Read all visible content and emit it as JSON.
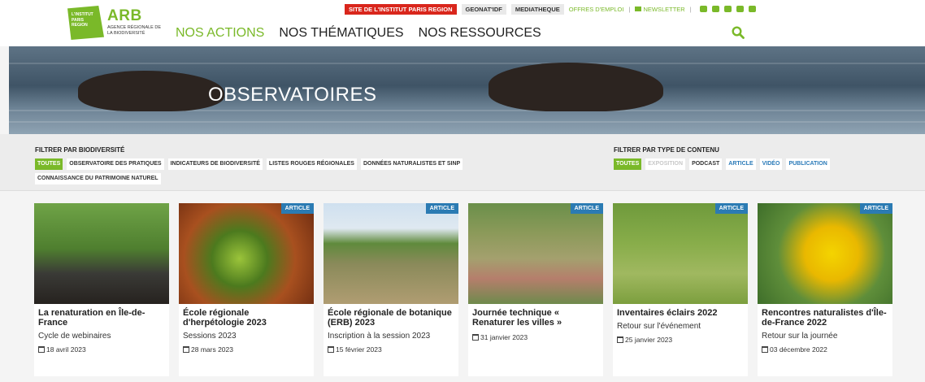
{
  "logo": {
    "box_lines": [
      "L'INSTITUT",
      "PARIS",
      "REGION"
    ],
    "name": "ARB",
    "subtitle": "AGENCE RÉGIONALE DE LA BIODIVERSITÉ"
  },
  "topbar": {
    "site_link": "SITE DE L'INSTITUT PARIS REGION",
    "geonat": "GEONAT'IDF",
    "mediatheque": "MEDIATHEQUE",
    "offres": "OFFRES D'EMPLOI",
    "separator": "|",
    "newsletter": "NEWSLETTER",
    "separator2": "|"
  },
  "nav": {
    "items": [
      "NOS ACTIONS",
      "NOS THÉMATIQUES",
      "NOS RESSOURCES"
    ]
  },
  "hero": {
    "title": "OBSERVATOIRES"
  },
  "filters": {
    "biodiversite": {
      "label": "FILTRER PAR BIODIVERSITÉ",
      "chips": [
        "TOUTES",
        "OBSERVATOIRE DES PRATIQUES",
        "INDICATEURS DE BIODIVERSITÉ",
        "LISTES ROUGES RÉGIONALES",
        "DONNÉES NATURALISTES ET SINP",
        "CONNAISSANCE DU PATRIMOINE NATUREL"
      ]
    },
    "type": {
      "label": "FILTRER PAR TYPE DE CONTENU",
      "chips": [
        "TOUTES",
        "EXPOSITION",
        "PODCAST",
        "ARTICLE",
        "VIDÉO",
        "PUBLICATION"
      ]
    }
  },
  "colors": {
    "accent": "#7ab929",
    "badge": "#2b7bb3",
    "red": "#d9261c"
  },
  "cards": [
    {
      "badge": "",
      "title": "La renaturation en Île-de-France",
      "subtitle": "Cycle de webinaires",
      "date": "18 avril 2023"
    },
    {
      "badge": "ARTICLE",
      "title": "École régionale d'herpétologie 2023",
      "subtitle": "Sessions 2023",
      "date": "28 mars 2023"
    },
    {
      "badge": "ARTICLE",
      "title": "École régionale de botanique (ERB) 2023",
      "subtitle": "Inscription à la session 2023",
      "date": "15 février 2023"
    },
    {
      "badge": "ARTICLE",
      "title": "Journée technique « Renaturer les villes »",
      "subtitle": "",
      "date": "31 janvier 2023"
    },
    {
      "badge": "ARTICLE",
      "title": "Inventaires éclairs 2022",
      "subtitle": "Retour sur l'événement",
      "date": "25 janvier 2023"
    },
    {
      "badge": "ARTICLE",
      "title": "Rencontres naturalistes d'Île-de-France 2022",
      "subtitle": "Retour sur la journée",
      "date": "03 décembre 2022"
    }
  ]
}
